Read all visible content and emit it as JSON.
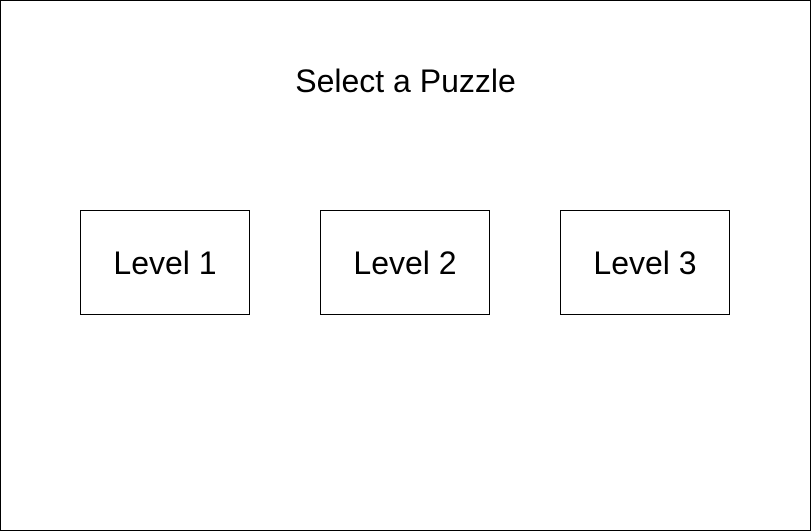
{
  "screen": {
    "title": "Select a Puzzle",
    "levels": [
      {
        "label": "Level 1"
      },
      {
        "label": "Level 2"
      },
      {
        "label": "Level 3"
      }
    ]
  },
  "colors": {
    "background": "#ffffff",
    "text": "#000000",
    "border": "#000000"
  }
}
